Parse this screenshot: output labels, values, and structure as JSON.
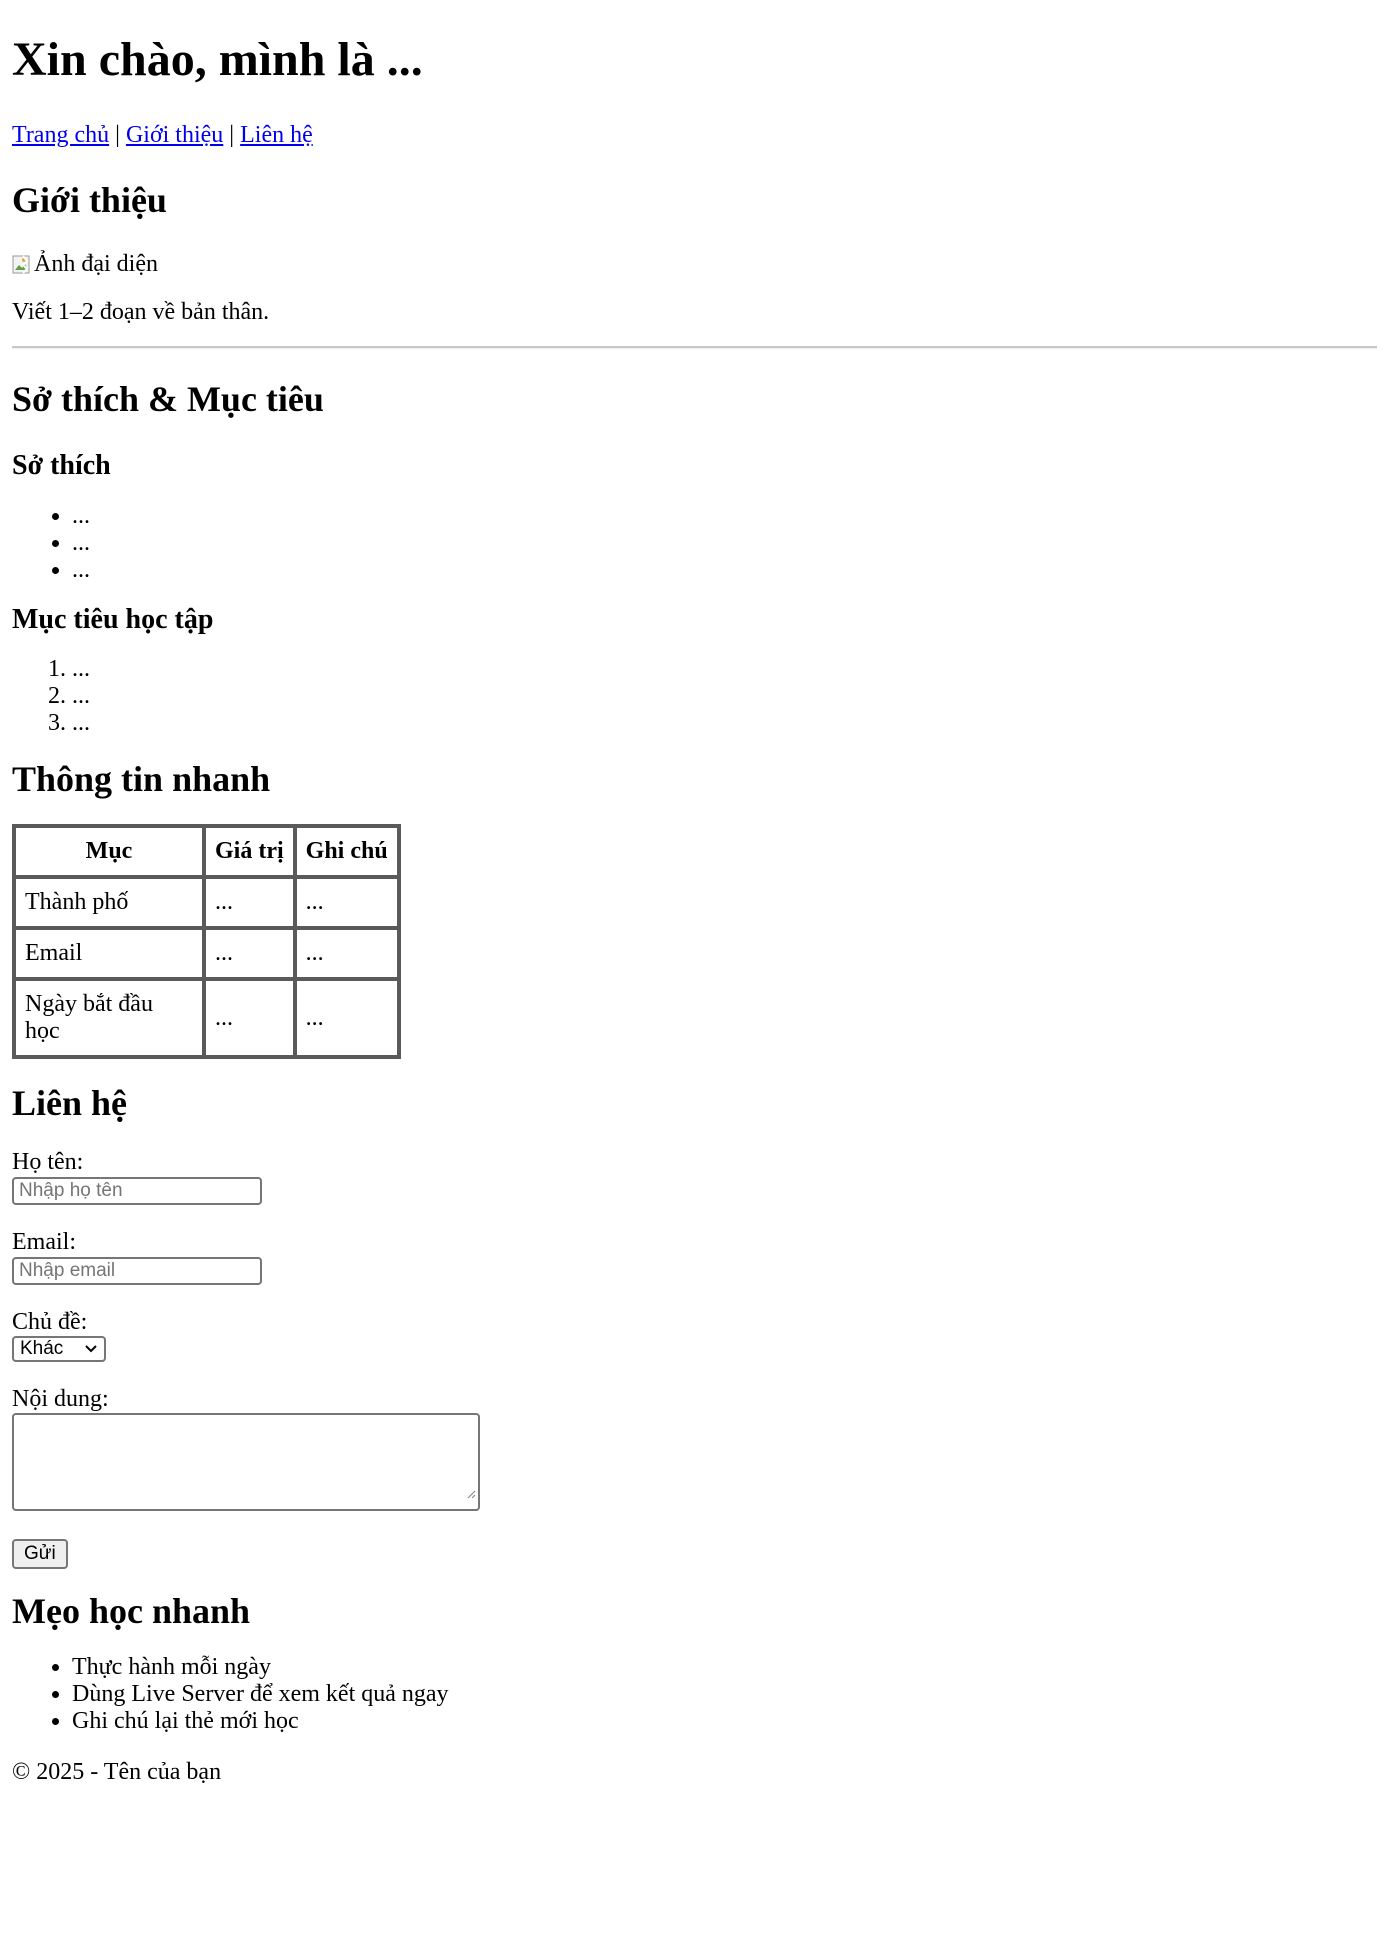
{
  "header": {
    "title": "Xin chào, mình là ...",
    "nav": [
      {
        "label": "Trang chủ"
      },
      {
        "label": "Giới thiệu"
      },
      {
        "label": "Liên hệ"
      }
    ],
    "nav_separator": "|"
  },
  "intro": {
    "heading": "Giới thiệu",
    "avatar_alt": "Ảnh đại diện",
    "text": "Viết 1–2 đoạn về bản thân."
  },
  "interests": {
    "heading": "Sở thích & Mục tiêu",
    "hobbies_heading": "Sở thích",
    "hobbies": [
      "...",
      "...",
      "..."
    ],
    "goals_heading": "Mục tiêu học tập",
    "goals": [
      "...",
      "...",
      "..."
    ]
  },
  "quick_info": {
    "heading": "Thông tin nhanh",
    "columns": [
      "Mục",
      "Giá trị",
      "Ghi chú"
    ],
    "rows": [
      [
        "Thành phố",
        "...",
        "..."
      ],
      [
        "Email",
        "...",
        "..."
      ],
      [
        "Ngày bắt đầu học",
        "...",
        "..."
      ]
    ]
  },
  "contact": {
    "heading": "Liên hệ",
    "name_label": "Họ tên:",
    "name_placeholder": "Nhập họ tên",
    "email_label": "Email:",
    "email_placeholder": "Nhập email",
    "topic_label": "Chủ đề:",
    "topic_selected": "Khác",
    "message_label": "Nội dung:",
    "submit_label": "Gửi"
  },
  "tips": {
    "heading": "Mẹo học nhanh",
    "items": [
      "Thực hành mỗi ngày",
      "Dùng Live Server để xem kết quả ngay",
      "Ghi chú lại thẻ mới học"
    ]
  },
  "footer": {
    "text": "© 2025 - Tên của bạn"
  }
}
